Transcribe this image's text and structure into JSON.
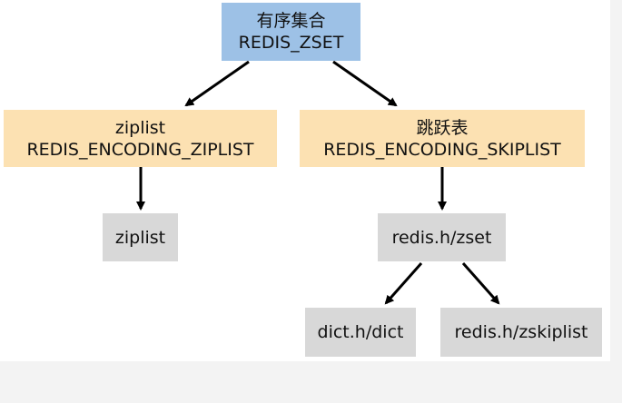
{
  "diagram": {
    "root": {
      "line1": "有序集合",
      "line2": "REDIS_ZSET"
    },
    "ziplist_encoding": {
      "line1": "ziplist",
      "line2": "REDIS_ENCODING_ZIPLIST"
    },
    "skiplist_encoding": {
      "line1": "跳跃表",
      "line2": "REDIS_ENCODING_SKIPLIST"
    },
    "ziplist_impl": {
      "label": "ziplist"
    },
    "zset_struct": {
      "label": "redis.h/zset"
    },
    "dict_struct": {
      "label": "dict.h/dict"
    },
    "zskiplist_struct": {
      "label": "redis.h/zskiplist"
    }
  },
  "colors": {
    "root": "#9dc1e6",
    "encoding": "#fce1b2",
    "structure": "#d8d8d8",
    "arrow": "#000000"
  }
}
